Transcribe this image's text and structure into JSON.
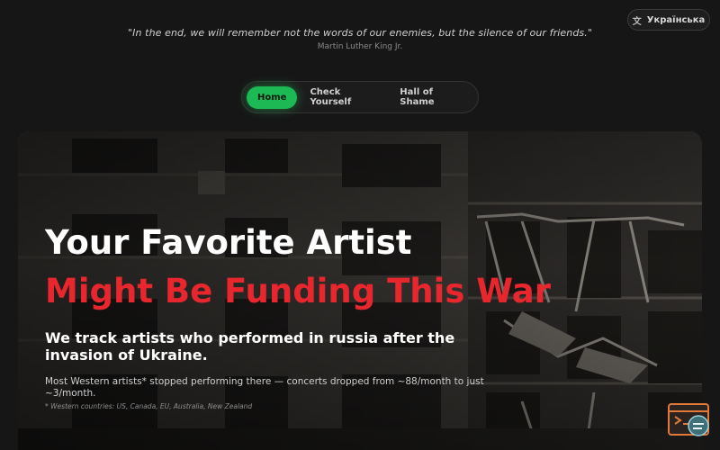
{
  "language": {
    "label": "Українська",
    "icon": "translate-icon"
  },
  "quote": {
    "text": "\"In the end, we will remember not the words of our enemies, but the silence of our friends.\"",
    "author": "Martin Luther King Jr."
  },
  "nav": {
    "items": [
      {
        "label": "Home",
        "active": true
      },
      {
        "label": "Check Yourself",
        "active": false
      },
      {
        "label": "Hall of Shame",
        "active": false
      }
    ]
  },
  "hero": {
    "title_line1": "Your Favorite Artist",
    "title_line2": "Might Be Funding This War",
    "subtitle": "We track artists who performed in russia after the invasion of Ukraine.",
    "description": "Most Western artists* stopped performing there — concerts dropped from ~88/month to just ~3/month.",
    "footnote": "* Western countries: US, Canada, EU, Australia, New Zealand"
  },
  "colors": {
    "accent_green": "#1db954",
    "accent_red": "#e7272d",
    "background": "#161616"
  },
  "floating_icon": "help-chat-icon"
}
